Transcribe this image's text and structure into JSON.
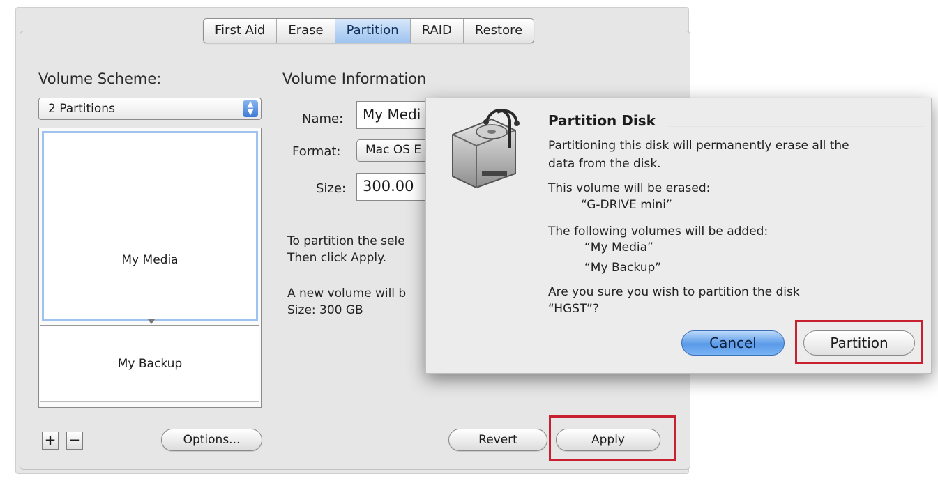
{
  "tabs": [
    "First Aid",
    "Erase",
    "Partition",
    "RAID",
    "Restore"
  ],
  "active_tab": "Partition",
  "volume_scheme": {
    "label": "Volume Scheme:",
    "selected": "2 Partitions",
    "partitions": [
      "My Media",
      "My Backup"
    ]
  },
  "volume_info": {
    "heading": "Volume Information",
    "name_label": "Name:",
    "name_value": "My Medi",
    "format_label": "Format:",
    "format_value": "Mac OS E",
    "size_label": "Size:",
    "size_value": "300.00"
  },
  "instructions": {
    "line1": "To partition the sele",
    "line2": "Then click Apply.",
    "line3": "A new volume will b",
    "line4": "Size: 300 GB"
  },
  "buttons": {
    "plus": "+",
    "minus": "−",
    "options": "Options...",
    "revert": "Revert",
    "apply": "Apply"
  },
  "dialog": {
    "title": "Partition Disk",
    "warning_line1": "Partitioning this disk will permanently erase all the",
    "warning_line2": "data from the disk.",
    "erased_label": "This volume will be erased:",
    "erased_volume": "“G-DRIVE mini”",
    "added_label": "The following volumes will be added:",
    "added_volumes": [
      "“My Media”",
      "“My Backup”"
    ],
    "confirm_line1": "Are you sure you wish to partition the disk",
    "confirm_line2": "“HGST”?",
    "cancel": "Cancel",
    "partition": "Partition"
  },
  "colors": {
    "highlight_red": "#c8202f",
    "selection_blue": "#9fc2ee",
    "default_button_blue": "#5a9ae8"
  }
}
